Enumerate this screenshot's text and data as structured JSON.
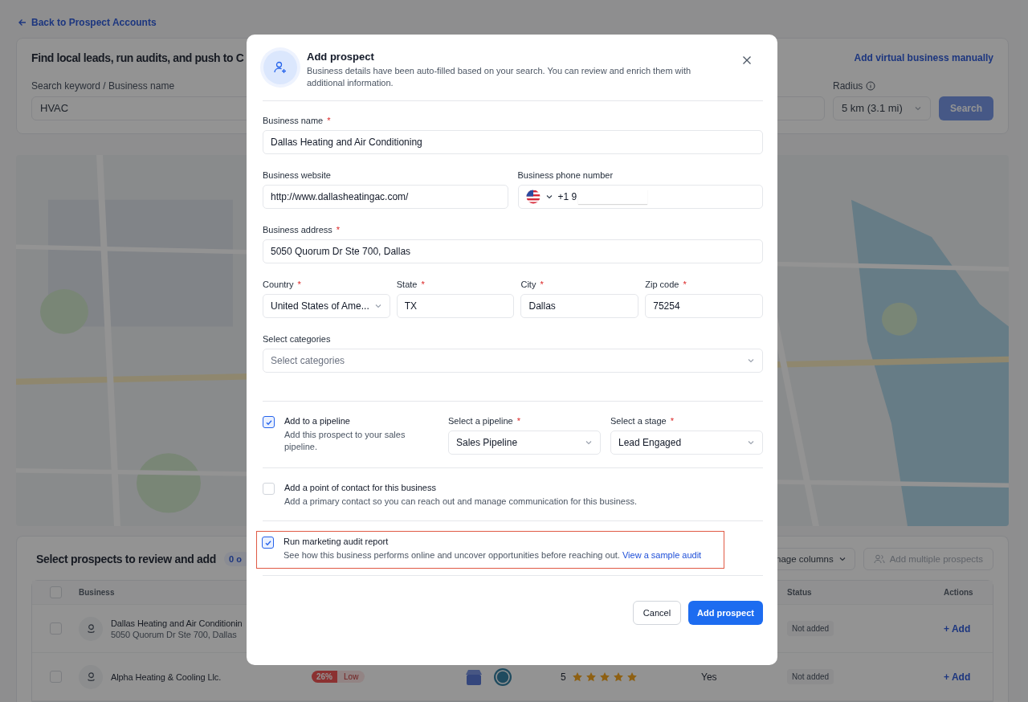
{
  "back_link": "Back to Prospect Accounts",
  "search_card": {
    "title": "Find local leads, run audits, and push to C",
    "action_link": "Add virtual business manually",
    "keyword": {
      "label": "Search keyword / Business name",
      "value": "HVAC"
    },
    "radius": {
      "label": "Radius",
      "value": "5 km (3.1 mi)"
    },
    "search_button": "Search"
  },
  "prospects": {
    "title": "Select prospects to review and add",
    "count_badge": "0 o",
    "manage_columns": "nage columns",
    "add_multiple": {
      "label": "Add multiple prospects",
      "disabled": true
    },
    "columns": {
      "business": "Business",
      "status": "Status",
      "actions": "Actions"
    },
    "select_all_checked": false,
    "rows": [
      {
        "checked": false,
        "name": "Dallas Heating and Air Conditionin",
        "address": "5050 Quorum Dr Ste 700, Dallas",
        "status": "Not added",
        "action": "+ Add"
      },
      {
        "checked": false,
        "name": "Alpha Heating & Cooling Llc.",
        "score": "26%",
        "score_label": "Low",
        "rating": "5",
        "stars": 5,
        "listed": "Yes",
        "status": "Not added",
        "action": "+ Add"
      }
    ]
  },
  "modal": {
    "title": "Add prospect",
    "description": "Business details have been auto-filled based on your search. You can review and enrich them with additional information.",
    "fields": [
      [
        {
          "kind": "text",
          "label": "Business name",
          "required_mark": "*",
          "value": "Dallas Heating and Air Conditioning"
        }
      ],
      [
        {
          "kind": "text",
          "label": "Business website",
          "value": "http://www.dallasheatingac.com/"
        },
        {
          "kind": "phone",
          "label": "Business phone number",
          "value": "+1 9",
          "redacted": true
        }
      ],
      [
        {
          "kind": "text",
          "label": "Business address",
          "required_mark": "*",
          "value": "5050 Quorum Dr Ste 700, Dallas"
        }
      ],
      [
        {
          "kind": "select",
          "label": "Country",
          "required_mark": "*",
          "value": "United States of Ame..."
        },
        {
          "kind": "text",
          "label": "State",
          "required_mark": "*",
          "value": "TX"
        },
        {
          "kind": "text",
          "label": "City",
          "required_mark": "*",
          "value": "Dallas"
        },
        {
          "kind": "text",
          "label": "Zip code",
          "required_mark": "*",
          "value": "75254"
        }
      ],
      [
        {
          "kind": "select",
          "label": "Select categories",
          "placeholder": "Select categories"
        }
      ]
    ],
    "options": [
      {
        "kind": "pipeline",
        "checked": true,
        "highlighted": false,
        "title": "Add to a pipeline",
        "description": "Add this prospect to your sales pipeline.",
        "selects": [
          {
            "label": "Select a pipeline",
            "required_mark": "*",
            "value": "Sales Pipeline"
          },
          {
            "label": "Select a stage",
            "required_mark": "*",
            "value": "Lead Engaged"
          }
        ]
      },
      {
        "kind": "plain",
        "checked": false,
        "highlighted": false,
        "title": "Add a point of contact for this business",
        "description": "Add a primary contact so you can reach out and manage communication for this business."
      },
      {
        "kind": "link",
        "checked": true,
        "highlighted": true,
        "title": "Run marketing audit report",
        "description": "See how this business performs online and uncover opportunities before reaching out.",
        "link": "View a sample audit"
      }
    ],
    "buttons": {
      "cancel": "Cancel",
      "submit": "Add prospect"
    }
  }
}
